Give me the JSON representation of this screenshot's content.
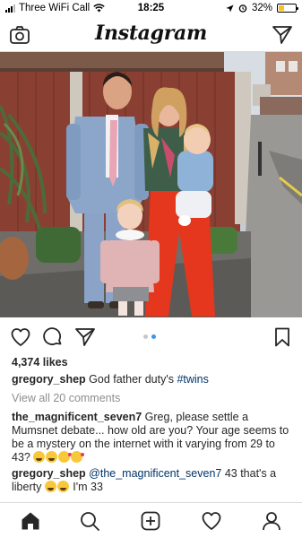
{
  "status_bar": {
    "carrier": "Three WiFi Call",
    "time": "18:25",
    "battery": "32%",
    "battery_level": 0.32
  },
  "header": {
    "logo": "Instagram",
    "left_icon": "camera-icon",
    "right_icon": "direct-message-icon"
  },
  "post": {
    "carousel": {
      "count": 2,
      "active_index": 1
    },
    "likes": "4,374 likes",
    "caption": {
      "username": "gregory_shep",
      "text": "God father duty's ",
      "hashtag": "#twins"
    },
    "view_all": "View all 20 comments",
    "comments": [
      {
        "username": "the_magnificent_seven7",
        "text": " Greg, please settle a Mumsnet debate... how old are you? Your age seems to be a mystery on the internet with it varying from 29 to 43? "
      },
      {
        "username": "gregory_shep",
        "mention": "@the_magnificent_seven7",
        "text": " 43 that's a liberty ",
        "text_after": " I'm 33"
      }
    ]
  },
  "tab_bar": {
    "items": [
      "home-icon",
      "search-icon",
      "new-post-icon",
      "activity-icon",
      "profile-icon"
    ],
    "active": "home-icon"
  },
  "colors": {
    "accent": "#3897f0",
    "link": "#003569",
    "muted": "#8e8e8e",
    "divider": "#dbdbdb",
    "battery": "#f6c026"
  }
}
